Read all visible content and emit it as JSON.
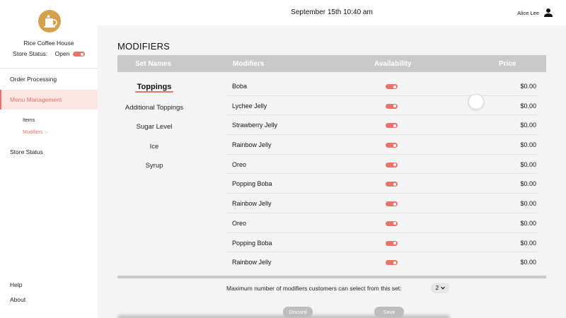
{
  "sidebar": {
    "logo_icon": "coffee-cup-icon",
    "store_name": "Rice Coffee House",
    "store_status_label": "Store Status:",
    "store_status_value": "Open",
    "nav": {
      "order_processing": "Order Processing",
      "menu_management": "Menu Management",
      "items": "Items",
      "modifiers": "Modifiers",
      "modifiers_chevron": "›",
      "store_status": "Store Status",
      "help": "Help",
      "about": "About"
    }
  },
  "header": {
    "datetime": "September 15th 10:40 am",
    "user_name": "Alice Lee",
    "user_icon": "person-icon"
  },
  "main": {
    "title": "MODIFIERS",
    "columns": {
      "set_names": "Set Names",
      "modifiers": "Modifiers",
      "availability": "Availability",
      "price": "Price"
    },
    "sets": [
      "Toppings",
      "Additional Toppings",
      "Sugar Level",
      "Ice",
      "Syrup"
    ],
    "rows": [
      {
        "name": "Boba",
        "available": true,
        "price": "$0.00"
      },
      {
        "name": "Lychee Jelly",
        "available": true,
        "price": "$0.00"
      },
      {
        "name": "Strawberry Jelly",
        "available": true,
        "price": "$0.00"
      },
      {
        "name": "Rainbow Jelly",
        "available": true,
        "price": "$0.00"
      },
      {
        "name": "Oreo",
        "available": true,
        "price": "$0.00"
      },
      {
        "name": "Popping Boba",
        "available": true,
        "price": "$0.00"
      },
      {
        "name": "Rainbow Jelly",
        "available": true,
        "price": "$0.00"
      },
      {
        "name": "Oreo",
        "available": true,
        "price": "$0.00"
      },
      {
        "name": "Popping Boba",
        "available": true,
        "price": "$0.00"
      },
      {
        "name": "Rainbow Jelly",
        "available": true,
        "price": "$0.00"
      }
    ],
    "max_label": "Maximum number of modifiers customers can select from this set:",
    "max_value": "2",
    "discard_label": "Discard",
    "save_label": "Save"
  },
  "colors": {
    "accent": "#e7736a",
    "header_gray": "#c9c9c9",
    "logo_gold": "#d4a24c"
  }
}
